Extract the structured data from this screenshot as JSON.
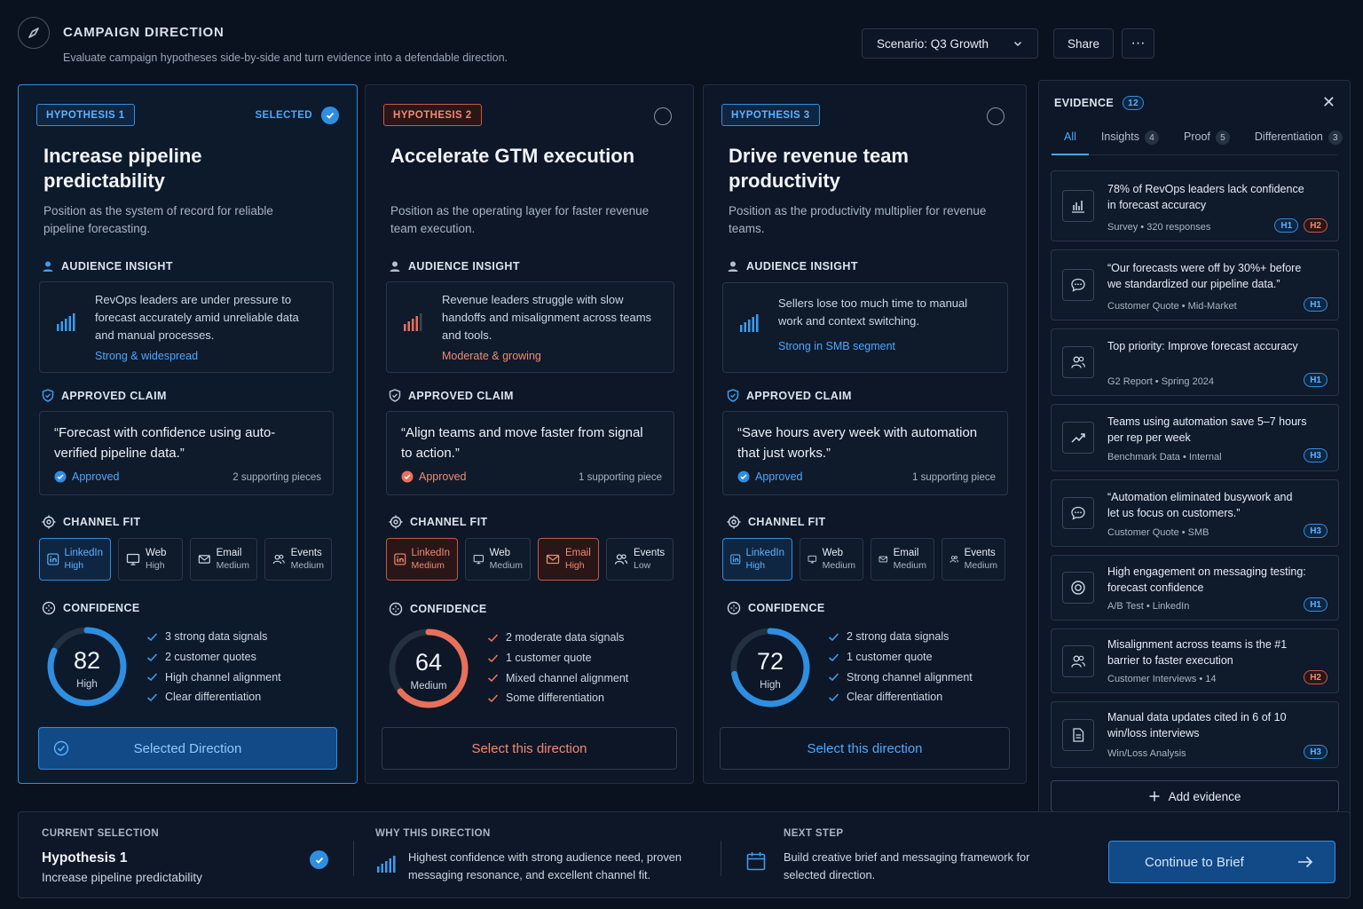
{
  "header": {
    "title": "CAMPAIGN DIRECTION",
    "subtitle": "Evaluate campaign hypotheses side-by-side and turn evidence into a defendable direction.",
    "scenario": "Scenario: Q3 Growth",
    "share": "Share",
    "more": "···"
  },
  "cards": [
    {
      "tag": "HYPOTHESIS 1",
      "selected_label": "SELECTED",
      "title": "Increase pipeline predictability",
      "desc": "Position as the system of record for reliable pipeline forecasting.",
      "audience_label": "AUDIENCE INSIGHT",
      "insight": "RevOps leaders are under pressure to forecast accurately amid unreliable data and manual processes.",
      "insight_tag": "Strong & widespread",
      "claim_label": "APPROVED CLAIM",
      "claim": "“Forecast with confidence using auto-verified pipeline data.”",
      "claim_status": "Approved",
      "claim_support": "2 supporting pieces",
      "channel_label": "CHANNEL FIT",
      "channels": [
        {
          "name": "LinkedIn",
          "level": "High"
        },
        {
          "name": "Web",
          "level": "High"
        },
        {
          "name": "Email",
          "level": "Medium"
        },
        {
          "name": "Events",
          "level": "Medium"
        }
      ],
      "confidence_label": "CONFIDENCE",
      "score": "82",
      "score_level": "High",
      "score_value": 82,
      "reasons": [
        "3 strong data signals",
        "2 customer quotes",
        "High channel alignment",
        "Clear differentiation"
      ],
      "cta": "Selected Direction"
    },
    {
      "tag": "HYPOTHESIS 2",
      "title": "Accelerate GTM execution",
      "desc": "Position as the operating layer for faster revenue team execution.",
      "audience_label": "AUDIENCE INSIGHT",
      "insight": "Revenue leaders struggle with slow handoffs and misalignment across teams and tools.",
      "insight_tag": "Moderate & growing",
      "claim_label": "APPROVED CLAIM",
      "claim": "“Align teams and move faster from signal to action.”",
      "claim_status": "Approved",
      "claim_support": "1 supporting piece",
      "channel_label": "CHANNEL FIT",
      "channels": [
        {
          "name": "LinkedIn",
          "level": "Medium"
        },
        {
          "name": "Web",
          "level": "Medium"
        },
        {
          "name": "Email",
          "level": "High"
        },
        {
          "name": "Events",
          "level": "Low"
        }
      ],
      "confidence_label": "CONFIDENCE",
      "score": "64",
      "score_level": "Medium",
      "score_value": 64,
      "reasons": [
        "2 moderate data signals",
        "1 customer quote",
        "Mixed channel alignment",
        "Some differentiation"
      ],
      "cta": "Select this direction"
    },
    {
      "tag": "HYPOTHESIS 3",
      "title": "Drive revenue team productivity",
      "desc": "Position as the productivity multiplier for revenue teams.",
      "audience_label": "AUDIENCE INSIGHT",
      "insight": "Sellers lose too much time to manual work and context switching.",
      "insight_tag": "Strong in SMB segment",
      "claim_label": "APPROVED CLAIM",
      "claim": "“Save hours avery week with automation that just works.”",
      "claim_status": "Approved",
      "claim_support": "1 supporting piece",
      "channel_label": "CHANNEL FIT",
      "channels": [
        {
          "name": "LinkedIn",
          "level": "High"
        },
        {
          "name": "Web",
          "level": "Medium"
        },
        {
          "name": "Email",
          "level": "Medium"
        },
        {
          "name": "Events",
          "level": "Medium"
        }
      ],
      "confidence_label": "CONFIDENCE",
      "score": "72",
      "score_level": "High",
      "score_value": 72,
      "reasons": [
        "2 strong data signals",
        "1 customer quote",
        "Strong channel alignment",
        "Clear differentiation"
      ],
      "cta": "Select this direction"
    }
  ],
  "evidence": {
    "title": "EVIDENCE",
    "count": "12",
    "tabs": [
      {
        "label": "All",
        "count": ""
      },
      {
        "label": "Insights",
        "count": "4"
      },
      {
        "label": "Proof",
        "count": "5"
      },
      {
        "label": "Differentiation",
        "count": "3"
      }
    ],
    "items": [
      {
        "icon": "bar-chart-icon",
        "text": "78% of RevOps leaders lack confidence in forecast accuracy",
        "source": "Survey",
        "detail": "320 responses",
        "badges": [
          "H1",
          "H2"
        ]
      },
      {
        "icon": "chat-icon",
        "text": "“Our forecasts were off by 30%+ before we standardized our pipeline data.”",
        "source": "Customer Quote",
        "detail": "Mid-Market",
        "badges": [
          "H1"
        ]
      },
      {
        "icon": "users-icon",
        "text": "Top priority: Improve forecast accuracy",
        "source": "G2 Report",
        "detail": "Spring 2024",
        "badges": [
          "H1"
        ]
      },
      {
        "icon": "trend-up-icon",
        "text": "Teams using automation save 5–7 hours per rep per week",
        "source": "Benchmark Data",
        "detail": "Internal",
        "badges": [
          "H3"
        ]
      },
      {
        "icon": "chat-icon",
        "text": "“Automation eliminated busywork and let us focus on customers.”",
        "source": "Customer Quote",
        "detail": "SMB",
        "badges": [
          "H3"
        ]
      },
      {
        "icon": "target-icon",
        "text": "High engagement on messaging testing: forecast confidence",
        "source": "A/B Test",
        "detail": "LinkedIn",
        "badges": [
          "H1"
        ]
      },
      {
        "icon": "users-icon",
        "text": "Misalignment across teams is the #1 barrier to faster execution",
        "source": "Customer Interviews",
        "detail": "14",
        "badges": [
          "H2"
        ]
      },
      {
        "icon": "document-icon",
        "text": "Manual data updates cited in 6 of 10 win/loss interviews",
        "source": "Win/Loss Analysis",
        "detail": "",
        "badges": [
          "H3"
        ]
      }
    ],
    "add_label": "Add evidence"
  },
  "footer": {
    "current_label": "CURRENT SELECTION",
    "current_title": "Hypothesis 1",
    "current_sub": "Increase pipeline predictability",
    "why_label": "WHY THIS DIRECTION",
    "why_text": "Highest confidence with strong audience need, proven messaging resonance, and excellent channel fit.",
    "next_label": "NEXT STEP",
    "next_text": "Build creative brief and messaging framework for selected direction.",
    "continue": "Continue to Brief"
  },
  "colors": {
    "accent_blue": "#2f8ee0",
    "accent_red": "#e8705a",
    "background": "#0a1220"
  }
}
